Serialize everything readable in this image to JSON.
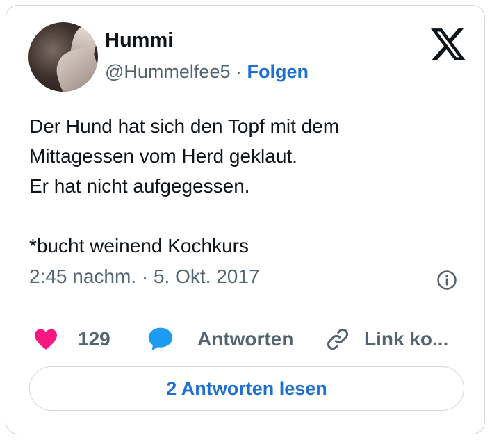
{
  "author": {
    "display_name": "Hummi",
    "handle": "@Hummelfee5",
    "separator": " · ",
    "follow_label": "Folgen"
  },
  "tweet": {
    "text": "Der Hund hat sich den Topf mit dem\nMittagessen vom Herd geklaut.\nEr hat nicht aufgegessen.\n\n*bucht weinend Kochkurs",
    "timestamp": "2:45 nachm. · 5. Okt. 2017"
  },
  "actions": {
    "like_count": "129",
    "reply_label": "Antworten",
    "link_label": "Link ko..."
  },
  "read_replies_label": "2 Antworten lesen",
  "icons": {
    "logo": "x-logo-icon",
    "info": "info-icon",
    "like": "heart-icon",
    "reply": "speech-bubble-icon",
    "link": "link-icon"
  },
  "colors": {
    "like": "#f91880",
    "reply": "#1d9bf0",
    "link_text": "#1d6fd1",
    "muted": "#536471",
    "border": "#cfd9de"
  }
}
